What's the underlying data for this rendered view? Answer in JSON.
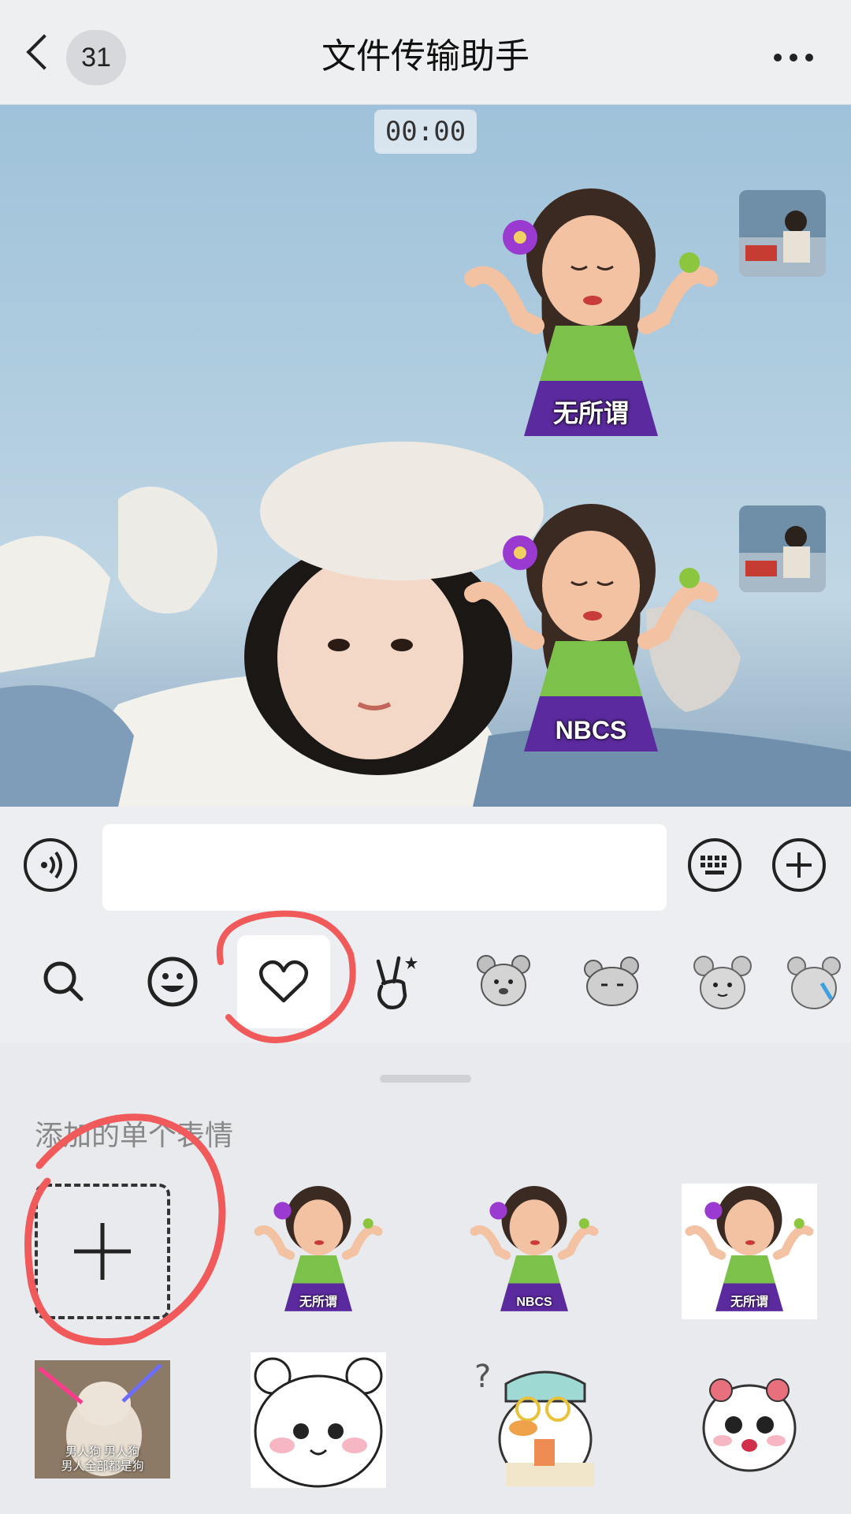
{
  "header": {
    "back_icon": "chevron-left-icon",
    "unread_count": "31",
    "title": "文件传输助手",
    "more_icon": "more-dots-icon"
  },
  "chat": {
    "timestamp": "00:00",
    "messages": [
      {
        "type": "sticker",
        "caption": "无所谓",
        "sender": "self"
      },
      {
        "type": "sticker",
        "caption": "NBCS",
        "sender": "self"
      }
    ]
  },
  "input_bar": {
    "voice_icon": "voice-icon",
    "text_value": "",
    "keyboard_icon": "keyboard-icon",
    "plus_icon": "plus-icon"
  },
  "emoji_tabs": [
    {
      "icon": "search-icon"
    },
    {
      "icon": "smiley-icon"
    },
    {
      "icon": "heart-icon",
      "active": true
    },
    {
      "icon": "peace-hand-icon"
    },
    {
      "icon": "mouse-sticker-1"
    },
    {
      "icon": "mouse-sticker-2"
    },
    {
      "icon": "mouse-sticker-3"
    },
    {
      "icon": "mouse-sticker-4"
    }
  ],
  "panel": {
    "section_title": "添加的单个表情",
    "items": [
      {
        "type": "add",
        "icon": "plus-icon"
      },
      {
        "type": "sticker",
        "caption": "无所谓"
      },
      {
        "type": "sticker",
        "caption": "NBCS"
      },
      {
        "type": "sticker",
        "caption": "无所谓"
      },
      {
        "type": "meme",
        "caption_line1": "男人狗 男人狗",
        "caption_line2": "男人全部都是狗"
      },
      {
        "type": "sticker",
        "icon": "bear-face-sticker"
      },
      {
        "type": "sticker",
        "icon": "duck-question-sticker"
      },
      {
        "type": "sticker",
        "icon": "cute-bun-sticker"
      }
    ]
  },
  "colors": {
    "annotation_red": "#f05a5a",
    "sticker_skirt": "#5b2a9e",
    "sticker_top": "#7cc24a"
  }
}
